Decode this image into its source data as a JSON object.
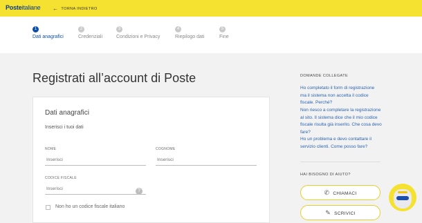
{
  "brand": {
    "logo_bold": "Poste",
    "logo_rest": "italiane"
  },
  "nav": {
    "back_label": "TORNA INDIETRO"
  },
  "steps": [
    {
      "num": "1",
      "label": "Dati anagrafici",
      "active": true
    },
    {
      "num": "2",
      "label": "Credenziali"
    },
    {
      "num": "3",
      "label": "Condizioni e Privacy"
    },
    {
      "num": "4",
      "label": "Riepilogo dati"
    },
    {
      "num": "5",
      "label": "Fine"
    }
  ],
  "page": {
    "title": "Registrati all’account di Poste"
  },
  "form": {
    "title": "Dati anagrafici",
    "subtitle": "Inserisci i tuoi dati",
    "nome": {
      "label": "NOME",
      "placeholder": "Inserisci",
      "value": ""
    },
    "cognome": {
      "label": "COGNOME",
      "placeholder": "Inserisci",
      "value": ""
    },
    "codice_fiscale": {
      "label": "CODICE FISCALE",
      "placeholder": "Inserisci",
      "value": ""
    },
    "help_glyph": "?",
    "no_cf_label": "Non ho un codice fiscale italiano",
    "no_cf_checked": false
  },
  "aside": {
    "related_heading": "DOMANDE COLLEGATE",
    "links": [
      "Ho completato il form di registrazione ma il sistema non accetta il codice fiscale. Perché?",
      "Non riesco a completare la registrazione al sito. Il sistema dice che il mio codice fiscale risulta già inserito. Che cosa devo fare?",
      "Ho un problema e devo contattare il servizio clienti. Come posso fare?"
    ],
    "help_heading": "HAI BISOGNO DI AIUTO?",
    "call_label": "CHIAMACI",
    "write_label": "SCRIVICI"
  },
  "icons": {
    "back": "arrow-left-icon",
    "call": "phone-icon",
    "write": "pencil-icon",
    "help": "question-icon",
    "assistant": "chat-assistant-icon"
  },
  "colors": {
    "brand_yellow": "#f5e12f",
    "brand_blue": "#0a4ea8",
    "link_blue": "#2b64b0"
  }
}
